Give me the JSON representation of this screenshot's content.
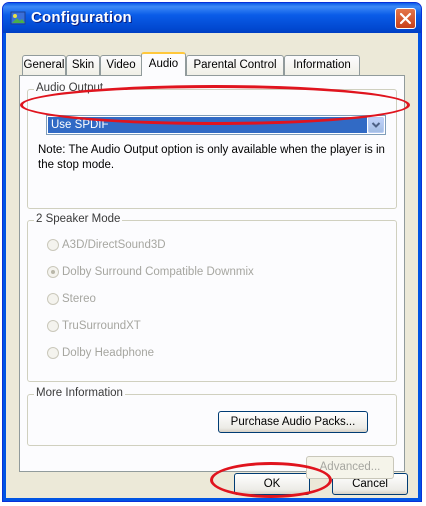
{
  "window": {
    "title": "Configuration"
  },
  "tabs": [
    {
      "label": "General"
    },
    {
      "label": "Skin"
    },
    {
      "label": "Video"
    },
    {
      "label": "Audio"
    },
    {
      "label": "Parental Control"
    },
    {
      "label": "Information"
    }
  ],
  "audio_output": {
    "group_label": "Audio Output",
    "selected_value": "Use SPDIF",
    "note": "Note:  The Audio Output option is only available when the player is in the stop mode."
  },
  "speaker_mode": {
    "group_label": "2 Speaker Mode",
    "options": [
      {
        "label": "A3D/DirectSound3D",
        "selected": false
      },
      {
        "label": "Dolby Surround Compatible Downmix",
        "selected": true
      },
      {
        "label": "Stereo",
        "selected": false
      },
      {
        "label": "TruSurroundXT",
        "selected": false
      },
      {
        "label": "Dolby Headphone",
        "selected": false
      }
    ]
  },
  "more_info": {
    "group_label": "More Information",
    "purchase_button": "Purchase Audio Packs..."
  },
  "buttons": {
    "advanced": "Advanced...",
    "ok": "OK",
    "cancel": "Cancel"
  },
  "colors": {
    "titlebar": "#0a5ce8",
    "selection": "#316ac5",
    "highlight_ring": "#e0141e",
    "active_tab_accent": "#ffc83c"
  }
}
